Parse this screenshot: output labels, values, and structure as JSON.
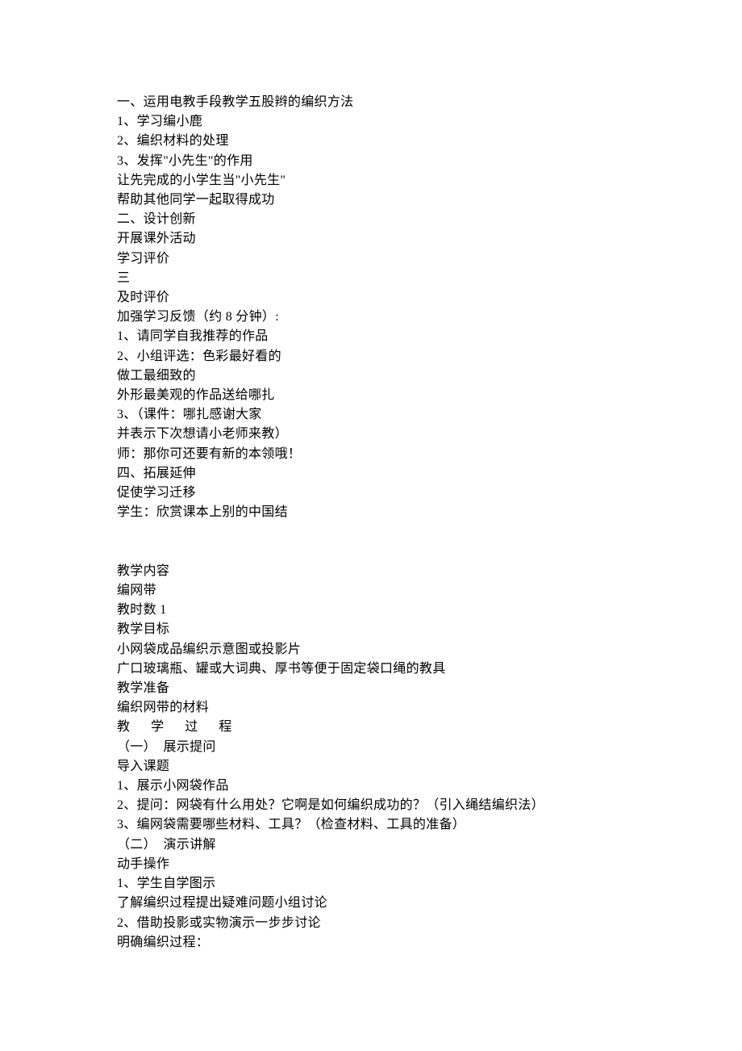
{
  "lines": [
    "一、运用电教手段教学五股辫的编织方法",
    "1、学习编小鹿",
    "2、编织材料的处理",
    "3、发挥\"小先生\"的作用",
    "让先完成的小学生当\"小先生\"",
    "帮助其他同学一起取得成功",
    "二、设计创新",
    "开展课外活动",
    "学习评价",
    "三",
    "及时评价",
    "加强学习反馈（约 8 分钟）:",
    "1、请同学自我推荐的作品",
    "2、小组评选：色彩最好看的",
    "做工最细致的",
    "外形最美观的作品送给哪扎",
    "3、（课件：哪扎感谢大家",
    "并表示下次想请小老师来教）",
    "师：那你可还要有新的本领哦！",
    "四、拓展延伸",
    "促使学习迁移",
    "学生：欣赏课本上别的中国结",
    "",
    "",
    "教学内容",
    "编网带",
    "教时数 1",
    "教学目标",
    "小网袋成品编织示意图或投影片",
    "广口玻璃瓶、罐或大词典、厚书等便于固定袋口绳的教具",
    "教学准备",
    "编织网带的材料",
    "教      学      过      程",
    "（一）  展示提问",
    "导入课题",
    "1、展示小网袋作品",
    "2、提问：网袋有什么用处？它啊是如何编织成功的？（引入绳结编织法）",
    "3、编网袋需要哪些材料、工具？（检查材料、工具的准备）",
    "（二）  演示讲解",
    "动手操作",
    "1、学生自学图示",
    "了解编织过程提出疑难问题小组讨论",
    "2、借助投影或实物演示一步步讨论",
    "明确编织过程："
  ]
}
